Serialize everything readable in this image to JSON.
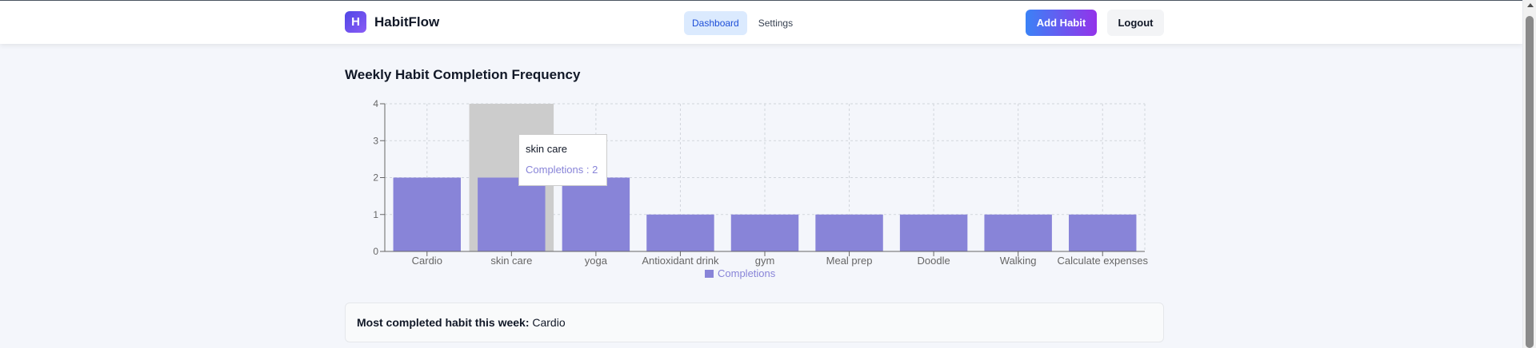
{
  "app": {
    "logo_letter": "H",
    "name": "HabitFlow"
  },
  "nav": {
    "items": [
      {
        "label": "Dashboard",
        "active": true
      },
      {
        "label": "Settings",
        "active": false
      }
    ],
    "add_button": "Add Habit",
    "logout_button": "Logout"
  },
  "page": {
    "chart_title": "Weekly Habit Completion Frequency"
  },
  "tooltip": {
    "category": "skin care",
    "label": "Completions : 2"
  },
  "summary": {
    "label": "Most completed habit this week:",
    "value": "Cardio"
  },
  "colors": {
    "bar": "#8884d8",
    "hover": "#cccccc",
    "accent_start": "#3b82f6",
    "accent_end": "#9333ea"
  },
  "chart_data": {
    "type": "bar",
    "categories": [
      "Cardio",
      "skin care",
      "yoga",
      "Antioxidant drink",
      "gym",
      "Meal prep",
      "Doodle",
      "Walking",
      "Calculate expenses"
    ],
    "series": [
      {
        "name": "Completions",
        "values": [
          2,
          2,
          2,
          1,
          1,
          1,
          1,
          1,
          1
        ]
      }
    ],
    "ylim": [
      0,
      4
    ],
    "yticks": [
      0,
      1,
      2,
      3,
      4
    ],
    "grid": true,
    "legend": "bottom-center",
    "hovered_category": "skin care"
  }
}
